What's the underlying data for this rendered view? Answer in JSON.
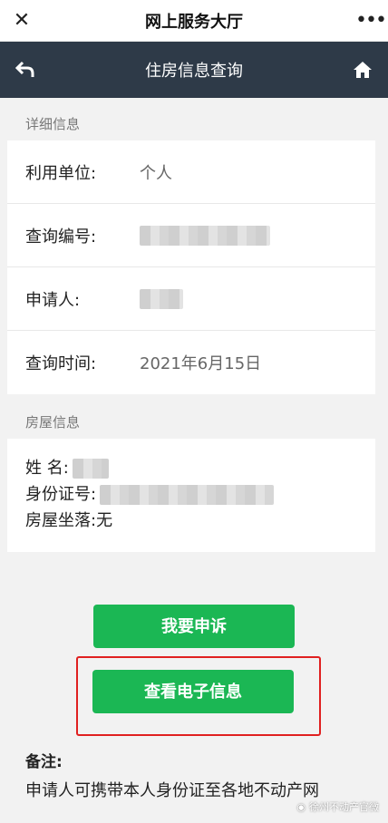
{
  "topbar": {
    "title": "网上服务大厅",
    "close_icon": "close-icon",
    "more_icon": "more-icon"
  },
  "navbar": {
    "title": "住房信息查询",
    "back_icon": "back-icon",
    "home_icon": "home-icon"
  },
  "details": {
    "section_label": "详细信息",
    "rows": [
      {
        "label": "利用单位:",
        "value": "个人"
      },
      {
        "label": "查询编号:",
        "value": ""
      },
      {
        "label": "申请人:",
        "value": ""
      },
      {
        "label": "查询时间:",
        "value": "2021年6月15日"
      }
    ]
  },
  "house": {
    "section_label": "房屋信息",
    "name_label": "姓 名:",
    "id_label": "身份证号:",
    "location_label": "房屋坐落:",
    "location_value": "无"
  },
  "buttons": {
    "appeal": "我要申诉",
    "view_electronic": "查看电子信息"
  },
  "remark": {
    "title": "备注:",
    "body": "申请人可携带本人身份证至各地不动产网"
  },
  "watermark": "徐州不动产官微",
  "colors": {
    "navbar": "#2e3a48",
    "button": "#1bb754",
    "highlight": "#e02020"
  }
}
